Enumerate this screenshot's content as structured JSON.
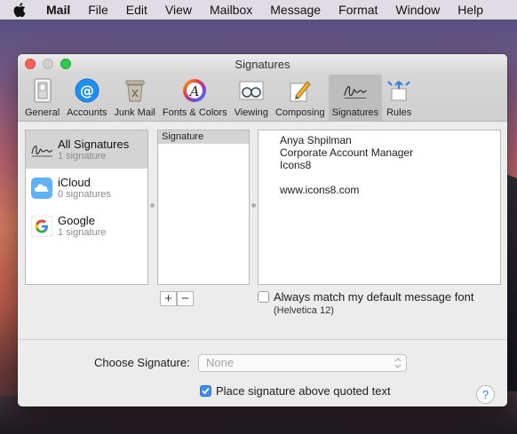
{
  "menubar": {
    "app": "Mail",
    "items": [
      "File",
      "Edit",
      "View",
      "Mailbox",
      "Message",
      "Format",
      "Window",
      "Help"
    ]
  },
  "window": {
    "title": "Signatures"
  },
  "toolbar": {
    "items": [
      {
        "label": "General",
        "icon": "switch-icon"
      },
      {
        "label": "Accounts",
        "icon": "at-icon"
      },
      {
        "label": "Junk Mail",
        "icon": "trash-icon"
      },
      {
        "label": "Fonts & Colors",
        "icon": "fonts-icon"
      },
      {
        "label": "Viewing",
        "icon": "glasses-icon"
      },
      {
        "label": "Composing",
        "icon": "pencil-icon"
      },
      {
        "label": "Signatures",
        "icon": "signature-icon"
      },
      {
        "label": "Rules",
        "icon": "rules-icon"
      }
    ],
    "active": "Signatures"
  },
  "accounts": [
    {
      "name": "All Signatures",
      "sub": "1 signature"
    },
    {
      "name": "iCloud",
      "sub": "0 signatures"
    },
    {
      "name": "Google",
      "sub": "1 signature"
    }
  ],
  "signatures": {
    "header": "Signature"
  },
  "preview": {
    "lines": [
      "Anya Shpilman",
      "Corporate Account Manager",
      "Icons8"
    ],
    "website": "www.icons8.com"
  },
  "controls": {
    "add": "+",
    "remove": "−",
    "match_font_label": "Always match my default message font",
    "match_font_note": "(Helvetica 12)",
    "choose_label": "Choose Signature:",
    "choose_value": "None",
    "above_label": "Place signature above quoted text",
    "help": "?"
  },
  "colors": {
    "accent": "#3d8df5",
    "close": "#fc605c",
    "maximize": "#34c84a"
  }
}
